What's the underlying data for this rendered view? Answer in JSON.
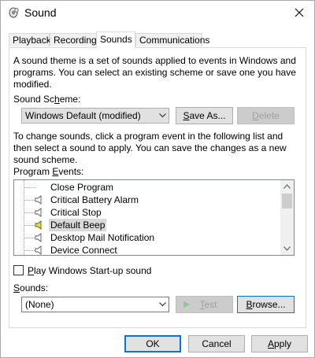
{
  "window": {
    "title": "Sound"
  },
  "tabs": [
    {
      "label": "Playback"
    },
    {
      "label": "Recording"
    },
    {
      "label": "Sounds"
    },
    {
      "label": "Communications"
    }
  ],
  "sounds_tab": {
    "intro_text": "A sound theme is a set of sounds applied to events in Windows and programs.  You can select an existing scheme or save one you have modified.",
    "scheme_label": "Sound Scheme:",
    "scheme_value": "Windows Default (modified)",
    "save_as_label": "Save As...",
    "delete_label": "Delete",
    "change_text": "To change sounds, click a program event in the following list and then select a sound to apply.  You can save the changes as a new sound scheme.",
    "events_label": "Program Events:",
    "events": [
      {
        "label": "Close Program",
        "has_sound": false,
        "selected": false
      },
      {
        "label": "Critical Battery Alarm",
        "has_sound": true,
        "selected": false
      },
      {
        "label": "Critical Stop",
        "has_sound": true,
        "selected": false
      },
      {
        "label": "Default Beep",
        "has_sound": true,
        "selected": true
      },
      {
        "label": "Desktop Mail Notification",
        "has_sound": true,
        "selected": false
      },
      {
        "label": "Device Connect",
        "has_sound": true,
        "selected": false
      }
    ],
    "startup_sound_label": "Play Windows Start-up sound",
    "startup_sound_checked": false,
    "sounds_label": "Sounds:",
    "sound_value": "(None)",
    "test_label": "Test",
    "browse_label": "Browse..."
  },
  "footer": {
    "ok_label": "OK",
    "cancel_label": "Cancel",
    "apply_label": "Apply"
  },
  "colors": {
    "accent": "#0078d7",
    "sound_icon_active": "#e8e800"
  }
}
